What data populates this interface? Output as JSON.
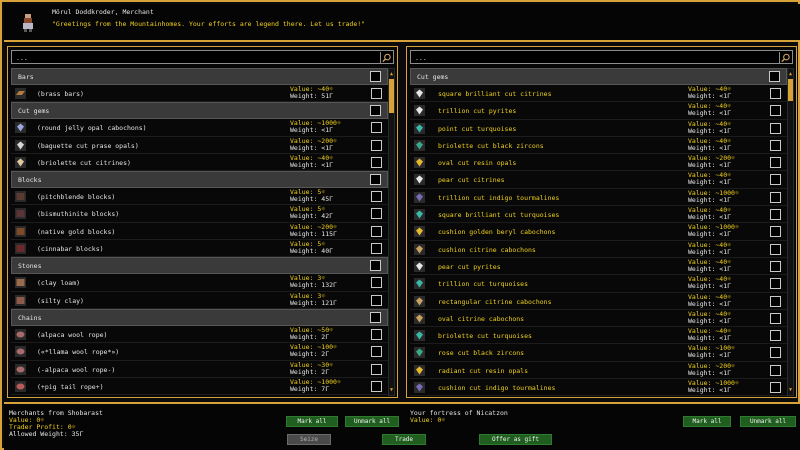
{
  "header": {
    "merchant_name": "Mörul Doddkroder, Merchant",
    "merchant_quote": "\"Greetings from the Mountainhomes.  Your efforts are legend there.  Let us trade!\""
  },
  "left_panel": {
    "search_text": "...",
    "rows": [
      {
        "kind": "cat",
        "label": "Bars"
      },
      {
        "kind": "item",
        "name": "(brass bars)",
        "value": "Value: ~40☼",
        "weight": "Weight: 51Γ",
        "icon": "bar-icon",
        "color": "#b57a3c"
      },
      {
        "kind": "cat",
        "label": "Cut gems"
      },
      {
        "kind": "item",
        "name": "(round jelly opal cabochons)",
        "value": "Value: ~1000☼",
        "weight": "Weight: <1Γ",
        "icon": "gem-icon",
        "color": "#9aa6e0"
      },
      {
        "kind": "item",
        "name": "(baguette cut prase opals)",
        "value": "Value: ~200☼",
        "weight": "Weight: <1Γ",
        "icon": "gem-icon",
        "color": "#d8d8d8"
      },
      {
        "kind": "item",
        "name": "(briolette cut citrines)",
        "value": "Value: ~40☼",
        "weight": "Weight: <1Γ",
        "icon": "gem-icon",
        "color": "#e0c9a0"
      },
      {
        "kind": "cat",
        "label": "Blocks"
      },
      {
        "kind": "item",
        "name": "(pitchblende blocks)",
        "value": "Value: 5☼",
        "weight": "Weight: 45Γ",
        "icon": "block-icon",
        "color": "#5a3a32"
      },
      {
        "kind": "item",
        "name": "(bismuthinite blocks)",
        "value": "Value: 5☼",
        "weight": "Weight: 42Γ",
        "icon": "block-icon",
        "color": "#5a3436"
      },
      {
        "kind": "item",
        "name": "(native gold blocks)",
        "value": "Value: ~200☼",
        "weight": "Weight: 115Γ",
        "icon": "block-icon",
        "color": "#7a4a2a"
      },
      {
        "kind": "item",
        "name": "(cinnabar blocks)",
        "value": "Value: 5☼",
        "weight": "Weight: 40Γ",
        "icon": "block-icon",
        "color": "#6a2a2a"
      },
      {
        "kind": "cat",
        "label": "Stones"
      },
      {
        "kind": "item",
        "name": "(clay loam)",
        "value": "Value: 3☼",
        "weight": "Weight: 132Γ",
        "icon": "stone-icon",
        "color": "#9a6a4a"
      },
      {
        "kind": "item",
        "name": "(silty clay)",
        "value": "Value: 3☼",
        "weight": "Weight: 121Γ",
        "icon": "stone-icon",
        "color": "#8a5a4a"
      },
      {
        "kind": "cat",
        "label": "Chains"
      },
      {
        "kind": "item",
        "name": "(alpaca wool rope)",
        "value": "Value: ~50☼",
        "weight": "Weight: 2Γ",
        "icon": "rope-icon",
        "color": "#a86a6a"
      },
      {
        "kind": "item",
        "name": "(«*llama wool rope*»)",
        "value": "Value: ~100☼",
        "weight": "Weight: 2Γ",
        "icon": "rope-icon",
        "color": "#a86a6a"
      },
      {
        "kind": "item",
        "name": "(-alpaca wool rope-)",
        "value": "Value: ~30☼",
        "weight": "Weight: 2Γ",
        "icon": "rope-icon",
        "color": "#a86a6a"
      },
      {
        "kind": "item",
        "name": "(+pig tail rope+)",
        "value": "Value: ~1000☼",
        "weight": "Weight: 7Γ",
        "icon": "rope-icon",
        "color": "#b85a5a"
      }
    ]
  },
  "right_panel": {
    "search_text": "...",
    "rows": [
      {
        "kind": "cat",
        "label": "Cut gems"
      },
      {
        "kind": "item",
        "name": "square brilliant cut citrines",
        "value": "Value: ~40☼",
        "weight": "Weight: <1Γ",
        "icon": "gem-icon",
        "color": "#e6e6e6"
      },
      {
        "kind": "item",
        "name": "trillion cut pyrites",
        "value": "Value: ~40☼",
        "weight": "Weight: <1Γ",
        "icon": "gem-icon",
        "color": "#e6e6e6"
      },
      {
        "kind": "item",
        "name": "point cut turquoises",
        "value": "Value: ~40☼",
        "weight": "Weight: <1Γ",
        "icon": "gem-icon",
        "color": "#3ab8a8"
      },
      {
        "kind": "item",
        "name": "briolette cut black zircons",
        "value": "Value: ~40☼",
        "weight": "Weight: <1Γ",
        "icon": "gem-icon",
        "color": "#3aa88a"
      },
      {
        "kind": "item",
        "name": "oval cut resin opals",
        "value": "Value: ~200☼",
        "weight": "Weight: <1Γ",
        "icon": "gem-icon",
        "color": "#e6b830"
      },
      {
        "kind": "item",
        "name": "pear cut citrines",
        "value": "Value: ~40☼",
        "weight": "Weight: <1Γ",
        "icon": "gem-icon",
        "color": "#e6e6e6"
      },
      {
        "kind": "item",
        "name": "trillion cut indigo tourmalines",
        "value": "Value: ~1000☼",
        "weight": "Weight: <1Γ",
        "icon": "gem-icon",
        "color": "#7a6ab8"
      },
      {
        "kind": "item",
        "name": "square brilliant cut turquoises",
        "value": "Value: ~40☼",
        "weight": "Weight: <1Γ",
        "icon": "gem-icon",
        "color": "#3ab8a8"
      },
      {
        "kind": "item",
        "name": "cushion golden beryl cabochons",
        "value": "Value: ~1000☼",
        "weight": "Weight: <1Γ",
        "icon": "gem-icon",
        "color": "#e6b830"
      },
      {
        "kind": "item",
        "name": "cushion citrine cabochons",
        "value": "Value: ~40☼",
        "weight": "Weight: <1Γ",
        "icon": "gem-icon",
        "color": "#c8a060"
      },
      {
        "kind": "item",
        "name": "pear cut pyrites",
        "value": "Value: ~40☼",
        "weight": "Weight: <1Γ",
        "icon": "gem-icon",
        "color": "#e6e6e6"
      },
      {
        "kind": "item",
        "name": "trillion cut turquoises",
        "value": "Value: ~40☼",
        "weight": "Weight: <1Γ",
        "icon": "gem-icon",
        "color": "#3ab8a8"
      },
      {
        "kind": "item",
        "name": "rectangular citrine cabochons",
        "value": "Value: ~40☼",
        "weight": "Weight: <1Γ",
        "icon": "gem-icon",
        "color": "#c8a060"
      },
      {
        "kind": "item",
        "name": "oval citrine cabochons",
        "value": "Value: ~40☼",
        "weight": "Weight: <1Γ",
        "icon": "gem-icon",
        "color": "#c8a060"
      },
      {
        "kind": "item",
        "name": "briolette cut turquoises",
        "value": "Value: ~40☼",
        "weight": "Weight: <1Γ",
        "icon": "gem-icon",
        "color": "#3ab8a8"
      },
      {
        "kind": "item",
        "name": "rose cut black zircons",
        "value": "Value: ~100☼",
        "weight": "Weight: <1Γ",
        "icon": "gem-icon",
        "color": "#3aa88a"
      },
      {
        "kind": "item",
        "name": "radiant cut resin opals",
        "value": "Value: ~200☼",
        "weight": "Weight: <1Γ",
        "icon": "gem-icon",
        "color": "#e6b830"
      },
      {
        "kind": "item",
        "name": "cushion cut indigo tourmalines",
        "value": "Value: ~1000☼",
        "weight": "Weight: <1Γ",
        "icon": "gem-icon",
        "color": "#7a6ab8"
      }
    ]
  },
  "footer": {
    "left_title": "Merchants from Shobarast",
    "left_value": "Value: 0☼",
    "trader_profit": "Trader Profit: 0☼",
    "allowed_weight": "Allowed Weight: 35Γ",
    "right_title": "Your fortress of Nicatzon",
    "right_value": "Value: 0☼",
    "mark_all_left": "Mark all",
    "unmark_all_left": "Unmark all",
    "mark_all_right": "Mark all",
    "unmark_all_right": "Unmark all",
    "seize": "Seize",
    "trade": "Trade",
    "offer": "Offer as gift"
  },
  "colors": {
    "frame": "#d8a23a",
    "value_text": "#f2d21e",
    "button_green": "#1f5e1f",
    "button_disabled": "#4a4a4a"
  }
}
